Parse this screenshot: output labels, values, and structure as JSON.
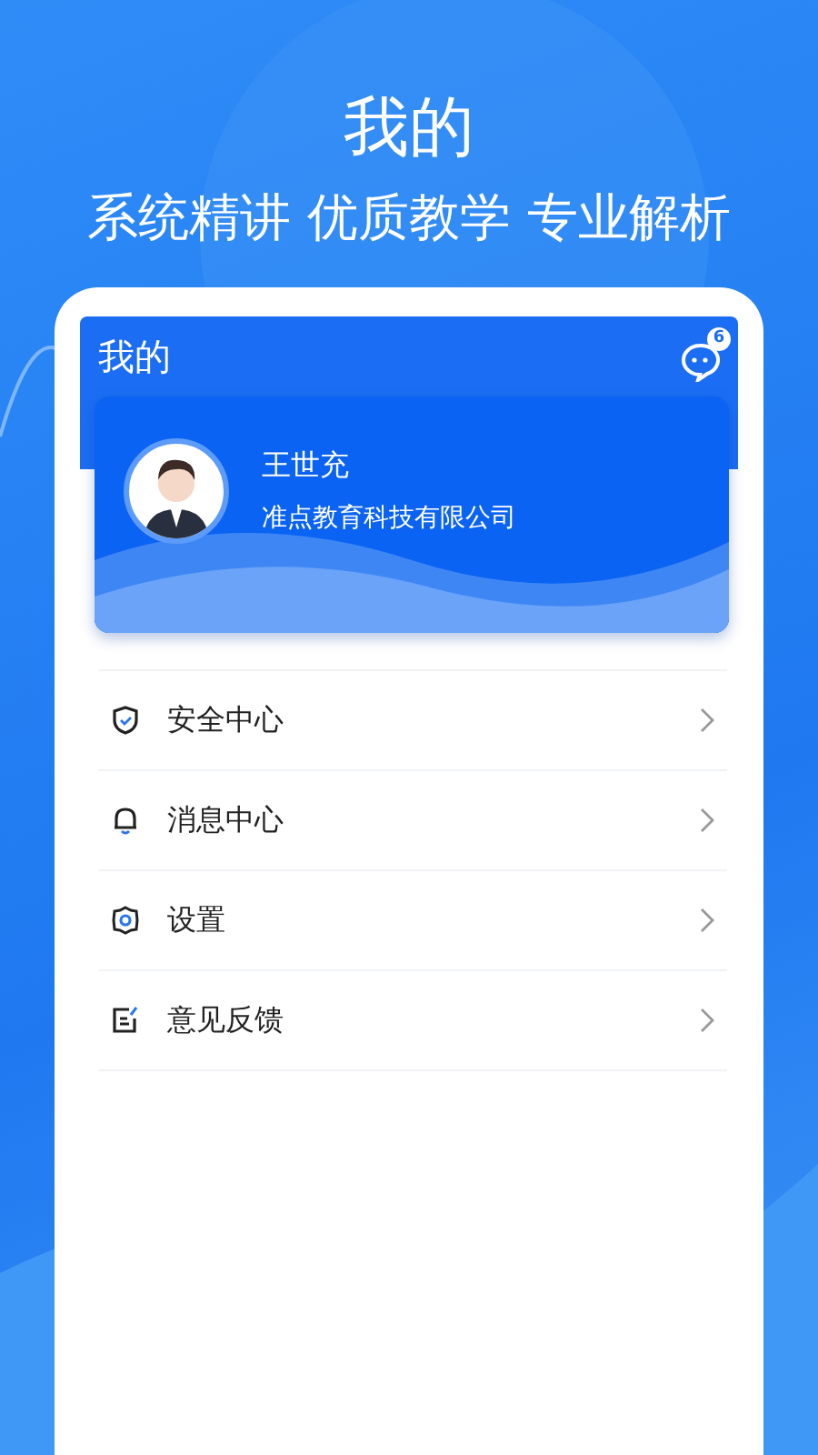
{
  "promo": {
    "title": "我的",
    "subtitle": "系统精讲 优质教学 专业解析"
  },
  "app": {
    "title": "我的",
    "message_badge": "6",
    "profile": {
      "name": "王世充",
      "organization": "准点教育科技有限公司"
    },
    "menu": [
      {
        "kind": "shield",
        "label": "安全中心"
      },
      {
        "kind": "bell",
        "label": "消息中心"
      },
      {
        "kind": "gear",
        "label": "设置"
      },
      {
        "kind": "feedback",
        "label": "意见反馈"
      }
    ]
  }
}
